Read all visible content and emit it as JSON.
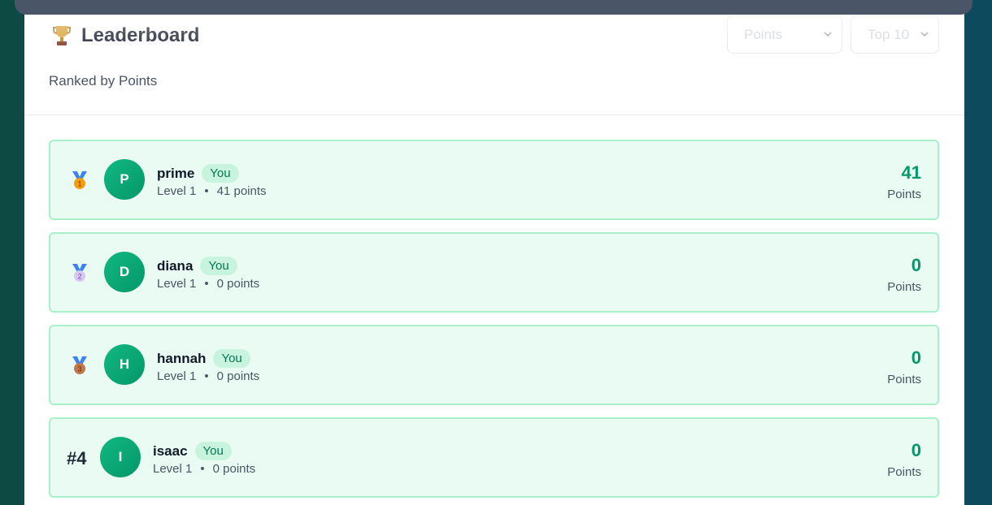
{
  "header": {
    "title": "Leaderboard",
    "subtitle": "Ranked by Points",
    "trophy_icon": "trophy-icon",
    "metric_select": {
      "selected": "Points"
    },
    "limit_select": {
      "selected": "Top 10"
    }
  },
  "colors": {
    "accent": "#059669",
    "row_bg": "#e9fbf2",
    "row_border": "#a7f0c9",
    "badge_bg": "#c8f4dd"
  },
  "entries": [
    {
      "rank_icon": "gold-medal-icon",
      "medal_number": "1",
      "initial": "P",
      "name": "prime",
      "badge": "You",
      "level": "Level 1",
      "bullet": "•",
      "points_text": "41 points",
      "score": "41",
      "score_label": "Points"
    },
    {
      "rank_icon": "silver-medal-icon",
      "medal_number": "2",
      "initial": "D",
      "name": "diana",
      "badge": "You",
      "level": "Level 1",
      "bullet": "•",
      "points_text": "0 points",
      "score": "0",
      "score_label": "Points"
    },
    {
      "rank_icon": "bronze-medal-icon",
      "medal_number": "3",
      "initial": "H",
      "name": "hannah",
      "badge": "You",
      "level": "Level 1",
      "bullet": "•",
      "points_text": "0 points",
      "score": "0",
      "score_label": "Points"
    },
    {
      "rank_label": "#4",
      "initial": "I",
      "name": "isaac",
      "badge": "You",
      "level": "Level 1",
      "bullet": "•",
      "points_text": "0 points",
      "score": "0",
      "score_label": "Points"
    }
  ]
}
